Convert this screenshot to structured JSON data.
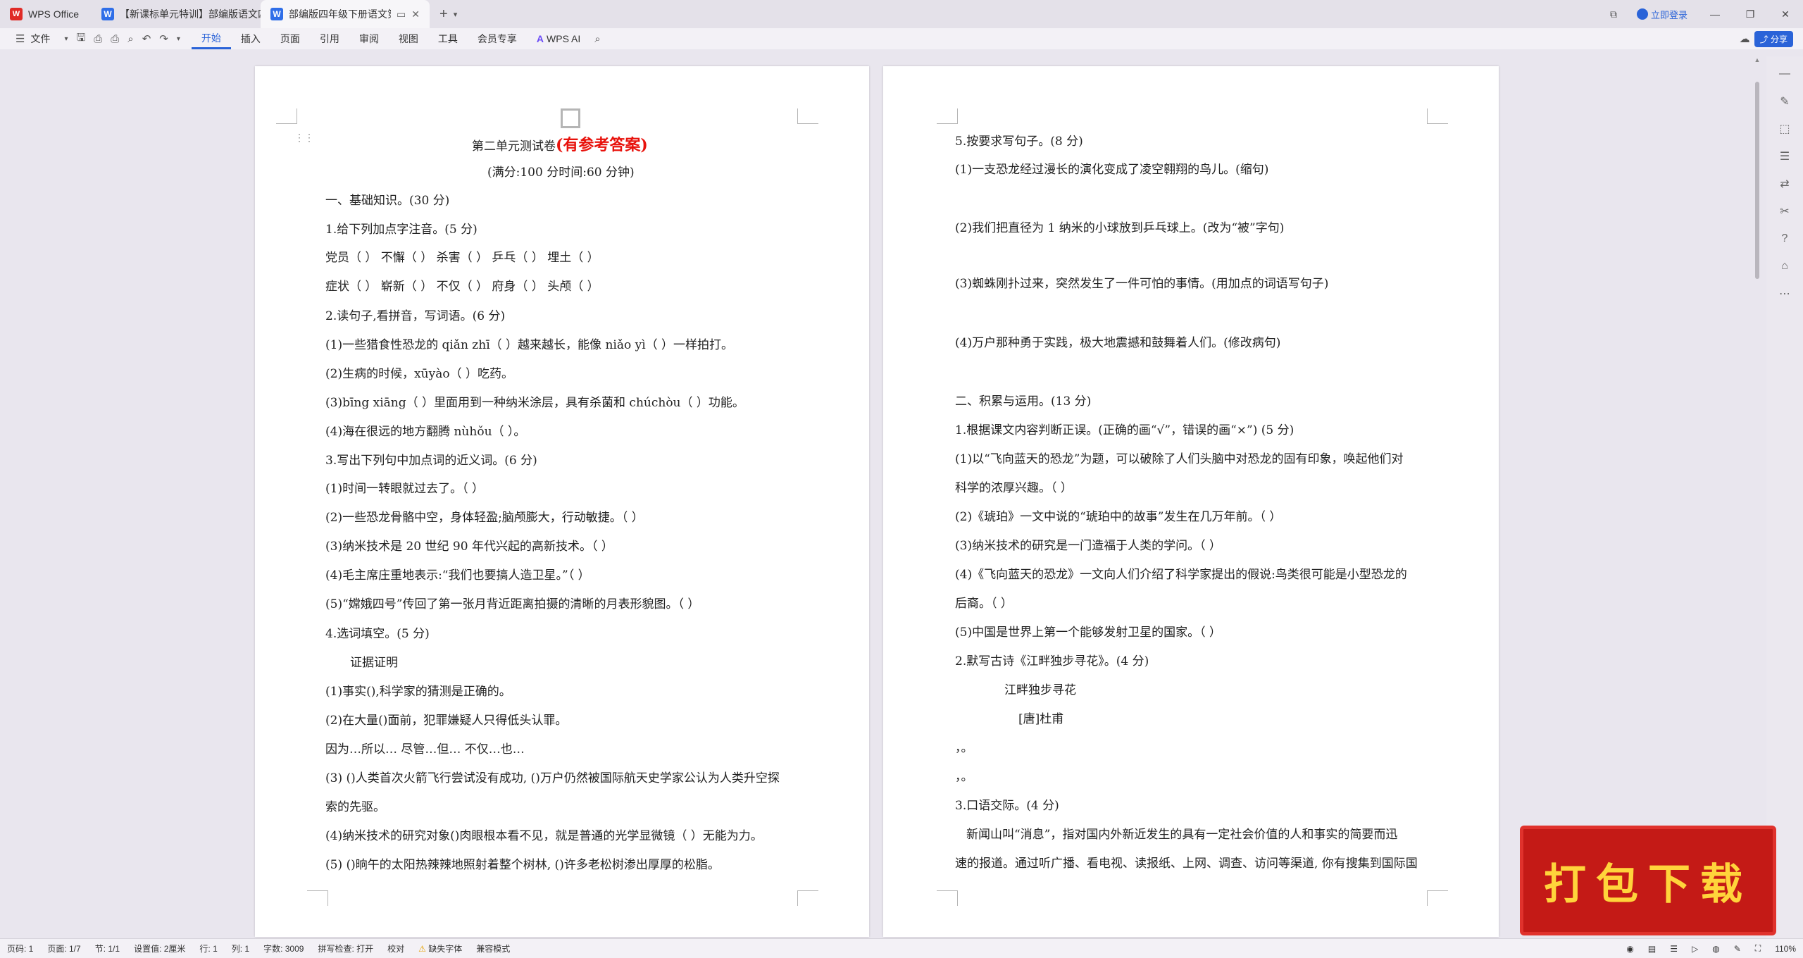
{
  "window": {
    "tabs": [
      {
        "label": "WPS Office"
      },
      {
        "label": "【新课标单元特训】部编版语文四年"
      },
      {
        "label": "部编版四年级下册语文第二单"
      }
    ],
    "login_label": "立即登录",
    "share_label": "分享"
  },
  "toolbar": {
    "file_label": "文件",
    "menu": [
      "开始",
      "插入",
      "页面",
      "引用",
      "审阅",
      "视图",
      "工具",
      "会员专享"
    ],
    "ai_label": "WPS AI"
  },
  "left_page": {
    "title_plain": "第二单元测试卷",
    "title_red": "(有参考答案)",
    "lines": [
      "(满分:100 分时间:60 分钟)",
      "一、基础知识。(30 分)",
      "1.给下列加点字注音。(5 分)",
      "党员（ ）  不懈（ ）  杀害（ ）  乒乓（ ）  埋土（ ）",
      "症状（ ）  崭新（ ）  不仅（ ）  府身（ ）  头颅（ ）",
      "2.读句子,看拼音，写词语。(6 分)",
      "(1)一些猎食性恐龙的 qiǎn zhī（ ）越来越长，能像 niǎo yì（ ）一样拍打。",
      "(2)生病的时候，xūyào（ ）吃药。",
      "(3)bīng xiāng（ ）里面用到一种纳米涂层，具有杀菌和 chúchòu（ ）功能。",
      "(4)海在很远的地方翻腾 nùhǒu（ ）。",
      "3.写出下列句中加点词的近义词。(6 分)",
      "(1)时间一转眼就过去了。（ ）",
      "(2)一些恐龙骨骼中空，身体轻盈;脑颅膨大，行动敏捷。（ ）",
      "(3)纳米技术是 20 世纪 90 年代兴起的高新技术。（ ）",
      "(4)毛主席庄重地表示:“我们也要搞人造卫星。”（ ）",
      "(5)“嫦娥四号”传回了第一张月背近距离拍摄的清晰的月表形貌图。（ ）",
      "4.选词填空。(5 分)",
      "证据证明",
      "(1)事实(),科学家的猜测是正确的。",
      "(2)在大量()面前，犯罪嫌疑人只得低头认罪。",
      "因为…所以…  尽管…但…  不仅…也…",
      "(3) ()人类首次火箭飞行尝试没有成功, ()万户仍然被国际航天史学家公认为人类升空探",
      "索的先驱。",
      "(4)纳米技术的研究对象()肉眼根本看不见，就是普通的光学显微镜（ ）无能为力。",
      "(5) ()晌午的太阳热辣辣地照射着整个树林, ()许多老松树渗出厚厚的松脂。"
    ]
  },
  "right_page": {
    "lines": [
      "5.按要求写句子。(8 分)",
      "(1)一支恐龙经过漫长的演化变成了凌空翱翔的鸟儿。(缩句)",
      "(2)我们把直径为 1 纳米的小球放到乒乓球上。(改为“被”字句)",
      "(3)蜘蛛刚扑过来，突然发生了一件可怕的事情。(用加点的词语写句子)",
      "(4)万户那种勇于实践，极大地震撼和鼓舞着人们。(修改病句)",
      "二、积累与运用。(13 分)",
      "1.根据课文内容判断正误。(正确的画“√”，错误的画“×”) (5 分)",
      "(1)以“飞向蓝天的恐龙”为题，可以破除了人们头脑中对恐龙的固有印象，唤起他们对",
      "科学的浓厚兴趣。（ ）",
      "(2)《琥珀》一文中说的“琥珀中的故事”发生在几万年前。（ ）",
      "(3)纳米技术的研究是一门造福于人类的学问。（ ）",
      "(4)《飞向蓝天的恐龙》一文向人们介绍了科学家提出的假说:鸟类很可能是小型恐龙的",
      "后裔。（ ）",
      "(5)中国是世界上第一个能够发射卫星的国家。（ ）",
      "2.默写古诗《江畔独步寻花》。(4 分)",
      "江畔独步寻花",
      "[唐]杜甫",
      "，。",
      "，。",
      "3.口语交际。(4 分)",
      "新闻山叫“消息”，指对国内外新近发生的具有一定社会价值的人和事实的简要而迅",
      "速的报道。通过听广播、看电视、读报纸、上网、调查、访问等渠道, 你有搜集到国际国"
    ]
  },
  "status_bar": {
    "items": [
      "页码: 1",
      "页面: 1/7",
      "节: 1/1",
      "设置值: 2厘米",
      "行: 1",
      "列: 1",
      "字数: 3009",
      "拼写检查: 打开",
      "校对",
      "缺失字体",
      "兼容模式"
    ],
    "zoom": "110%"
  },
  "banner": {
    "text": "打包下载"
  },
  "colors": {
    "accent": "#2a63d8",
    "title_red": "#e8120c",
    "banner_bg": "#c41a16",
    "banner_text": "#ffd43b"
  }
}
